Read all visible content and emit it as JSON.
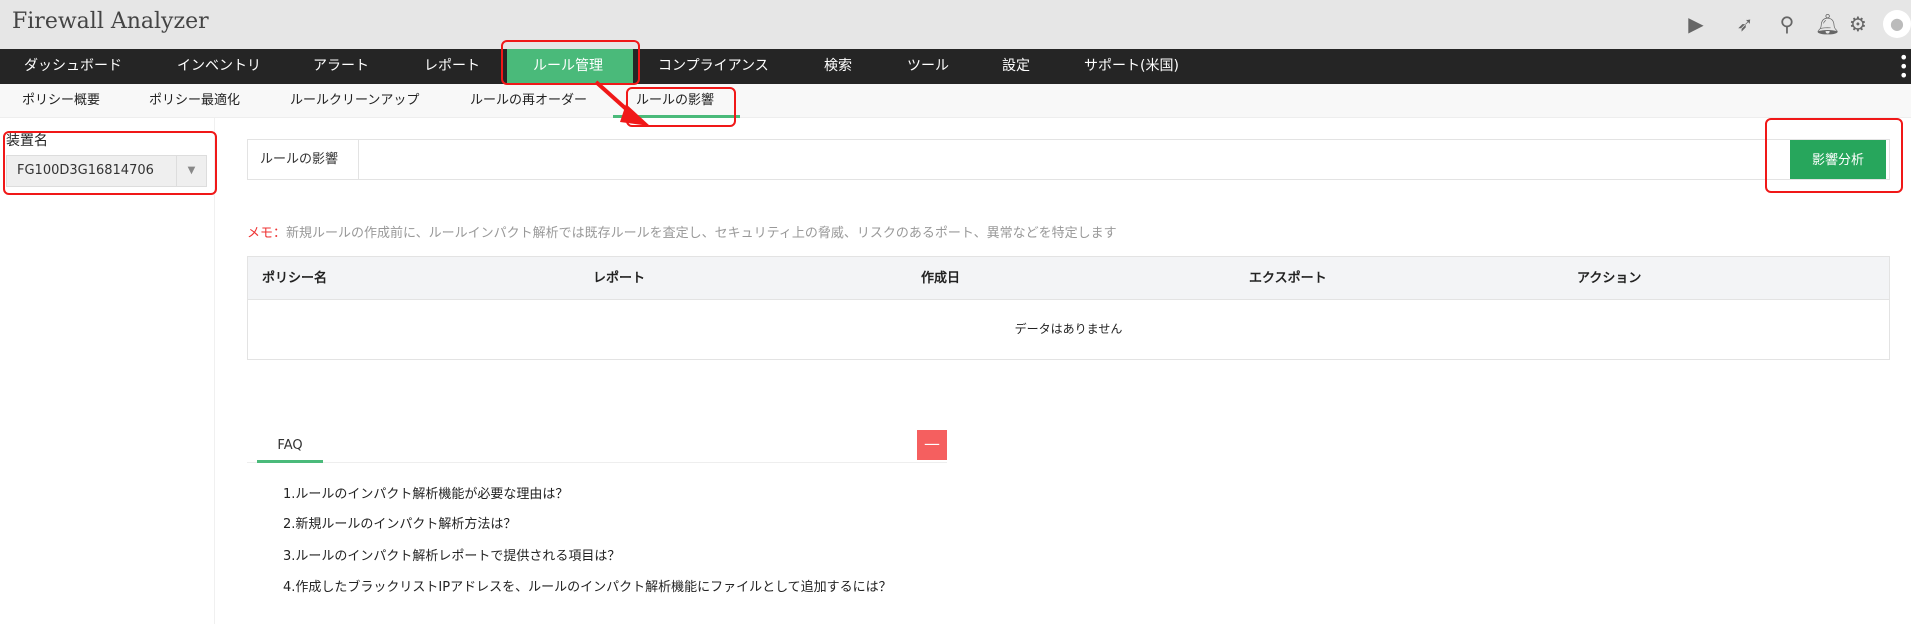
{
  "app_title": "Firewall Analyzer",
  "header_icons": [
    "presentation-icon",
    "rocket-icon",
    "search-icon",
    "bell-icon",
    "gear-icon",
    "user-avatar-icon"
  ],
  "nav": {
    "items": [
      "ダッシュボード",
      "インベントリ",
      "アラート",
      "レポート",
      "ルール管理",
      "コンプライアンス",
      "検索",
      "ツール",
      "設定",
      "サポート(米国)"
    ],
    "active": "ルール管理"
  },
  "subnav": {
    "items": [
      "ポリシー概要",
      "ポリシー最適化",
      "ルールクリーンアップ",
      "ルールの再オーダー",
      "ルールの影響"
    ],
    "active": "ルールの影響"
  },
  "sidebar": {
    "device_label": "装置名",
    "device_value": "FG100D3G16814706"
  },
  "main": {
    "impact_label": "ルールの影響",
    "analyze_button": "影響分析",
    "memo_key": "メモ：",
    "memo_text": "新規ルールの作成前に、ルールインパクト解析では既存ルールを査定し、セキュリティ上の脅威、リスクのあるポート、異常などを特定します",
    "table": {
      "columns": [
        "ポリシー名",
        "レポート",
        "作成日",
        "エクスポート",
        "アクション"
      ],
      "empty": "データはありません"
    },
    "faq": {
      "tab": "FAQ",
      "collapse": "—",
      "items": [
        "1.ルールのインパクト解析機能が必要な理由は？",
        "2.新規ルールのインパクト解析方法は？",
        "3.ルールのインパクト解析レポートで提供される項目は？",
        "4.作成したブラックリストIPアドレスを、ルールのインパクト解析機能にファイルとして追加するには？"
      ]
    }
  },
  "colors": {
    "accent": "#4aba7a",
    "button": "#27a65c",
    "nav_bg": "#252525",
    "annotation": "#f01818"
  }
}
